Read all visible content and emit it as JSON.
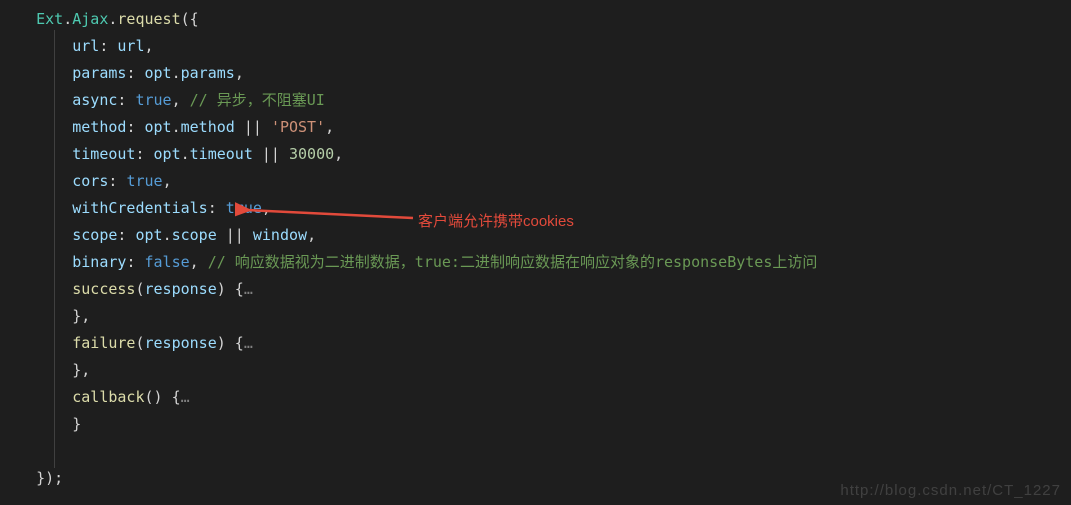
{
  "code": {
    "l1_type1": "Ext",
    "l1_type2": "Ajax",
    "l1_func": "request",
    "l2_prop": "url",
    "l2_var": "url",
    "l3_prop": "params",
    "l3_var": "opt",
    "l3_var2": "params",
    "l4_prop": "async",
    "l4_val": "true",
    "l4_comment": "// 异步，不阻塞UI",
    "l5_prop": "method",
    "l5_var": "opt",
    "l5_var2": "method",
    "l5_str": "'POST'",
    "l6_prop": "timeout",
    "l6_var": "opt",
    "l6_var2": "timeout",
    "l6_num": "30000",
    "l7_prop": "cors",
    "l7_val": "true",
    "l8_prop": "withCredentials",
    "l8_val": "true",
    "l9_prop": "scope",
    "l9_var": "opt",
    "l9_var2": "scope",
    "l9_var3": "window",
    "l10_prop": "binary",
    "l10_val": "false",
    "l10_comment": "// 响应数据视为二进制数据，true:二进制响应数据在响应对象的responseBytes上访问",
    "l11_func": "success",
    "l11_param": "response",
    "l11_dots": "…",
    "l12_brace": "},",
    "l13_func": "failure",
    "l13_param": "response",
    "l13_dots": "…",
    "l14_brace": "},",
    "l15_func": "callback",
    "l15_dots": "…",
    "l16_brace": "}",
    "l17_close": "});"
  },
  "annotation": {
    "text": "客户端允许携带cookies"
  },
  "watermark": "http://blog.csdn.net/CT_1227"
}
